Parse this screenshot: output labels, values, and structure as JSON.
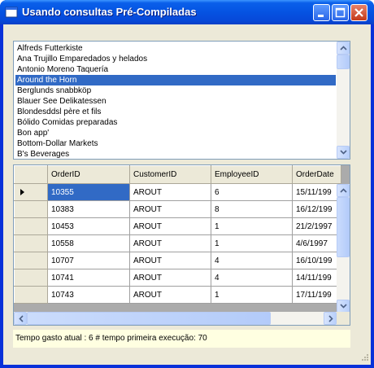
{
  "window": {
    "title": "Usando consultas Pré-Compiladas",
    "icon": "app-window-icon",
    "controls": [
      "minimize-icon",
      "maximize-icon",
      "close-icon"
    ],
    "colors": {
      "titlebar": "#0553e2",
      "selection": "#316ac5",
      "client": "#ece9d8",
      "status_bg": "#ffffe1"
    }
  },
  "customers": {
    "items": [
      "Alfreds Futterkiste",
      "Ana Trujillo Emparedados y helados",
      "Antonio Moreno Taquería",
      "Around the Horn",
      "Berglunds snabbköp",
      "Blauer See Delikatessen",
      "Blondesddsl père et fils",
      "Bólido Comidas preparadas",
      "Bon app'",
      "Bottom-Dollar Markets",
      "B's Beverages"
    ],
    "selected_index": 3
  },
  "orders": {
    "columns": [
      "OrderID",
      "CustomerID",
      "EmployeeID",
      "OrderDate"
    ],
    "rows": [
      [
        "10355",
        "AROUT",
        "6",
        "15/11/199"
      ],
      [
        "10383",
        "AROUT",
        "8",
        "16/12/199"
      ],
      [
        "10453",
        "AROUT",
        "1",
        "21/2/1997"
      ],
      [
        "10558",
        "AROUT",
        "1",
        "4/6/1997"
      ],
      [
        "10707",
        "AROUT",
        "4",
        "16/10/199"
      ],
      [
        "10741",
        "AROUT",
        "4",
        "14/11/199"
      ],
      [
        "10743",
        "AROUT",
        "1",
        "17/11/199"
      ]
    ],
    "current_row": 0
  },
  "status": {
    "text": "Tempo gasto atual : 6  # tempo primeira execução: 70"
  }
}
